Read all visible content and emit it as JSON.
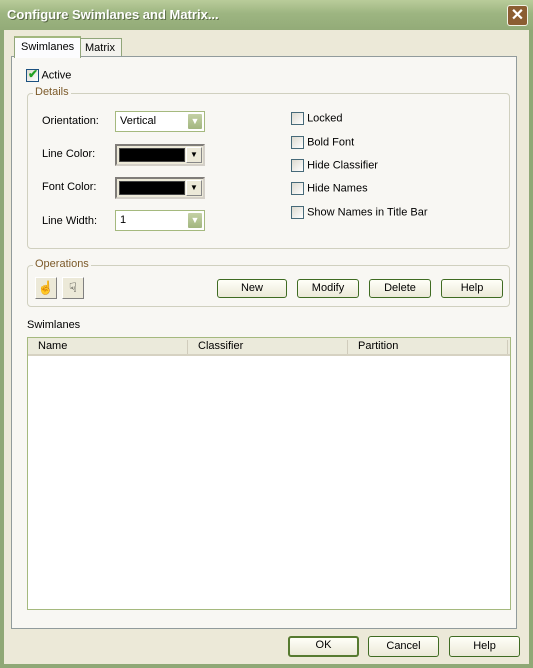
{
  "window": {
    "title": "Configure Swimlanes and Matrix...",
    "close_glyph": "✕"
  },
  "tabs": [
    {
      "label": "Swimlanes",
      "active": true
    },
    {
      "label": "Matrix",
      "active": false
    }
  ],
  "active_checkbox": {
    "label": "Active",
    "checked": true,
    "check_glyph": "✔"
  },
  "details": {
    "legend": "Details",
    "orientation": {
      "label": "Orientation:",
      "value": "Vertical"
    },
    "line_color": {
      "label": "Line Color:",
      "value": "#000000"
    },
    "font_color": {
      "label": "Font Color:",
      "value": "#000000"
    },
    "line_width": {
      "label": "Line Width:",
      "value": "1"
    },
    "dropdown_glyph": "▼",
    "options": [
      {
        "label": "Locked",
        "checked": false
      },
      {
        "label": "Bold Font",
        "checked": false
      },
      {
        "label": "Hide Classifier",
        "checked": false
      },
      {
        "label": "Hide Names",
        "checked": false
      },
      {
        "label": "Show Names in Title Bar",
        "checked": false
      }
    ]
  },
  "operations": {
    "legend": "Operations",
    "move_up_glyph": "☝",
    "move_down_glyph": "☟",
    "buttons": {
      "new": "New",
      "modify": "Modify",
      "delete": "Delete",
      "help": "Help"
    }
  },
  "swimlanes_list": {
    "label": "Swimlanes",
    "columns": [
      "Name",
      "Classifier",
      "Partition"
    ],
    "rows": []
  },
  "footer": {
    "ok": "OK",
    "cancel": "Cancel",
    "help": "Help"
  }
}
